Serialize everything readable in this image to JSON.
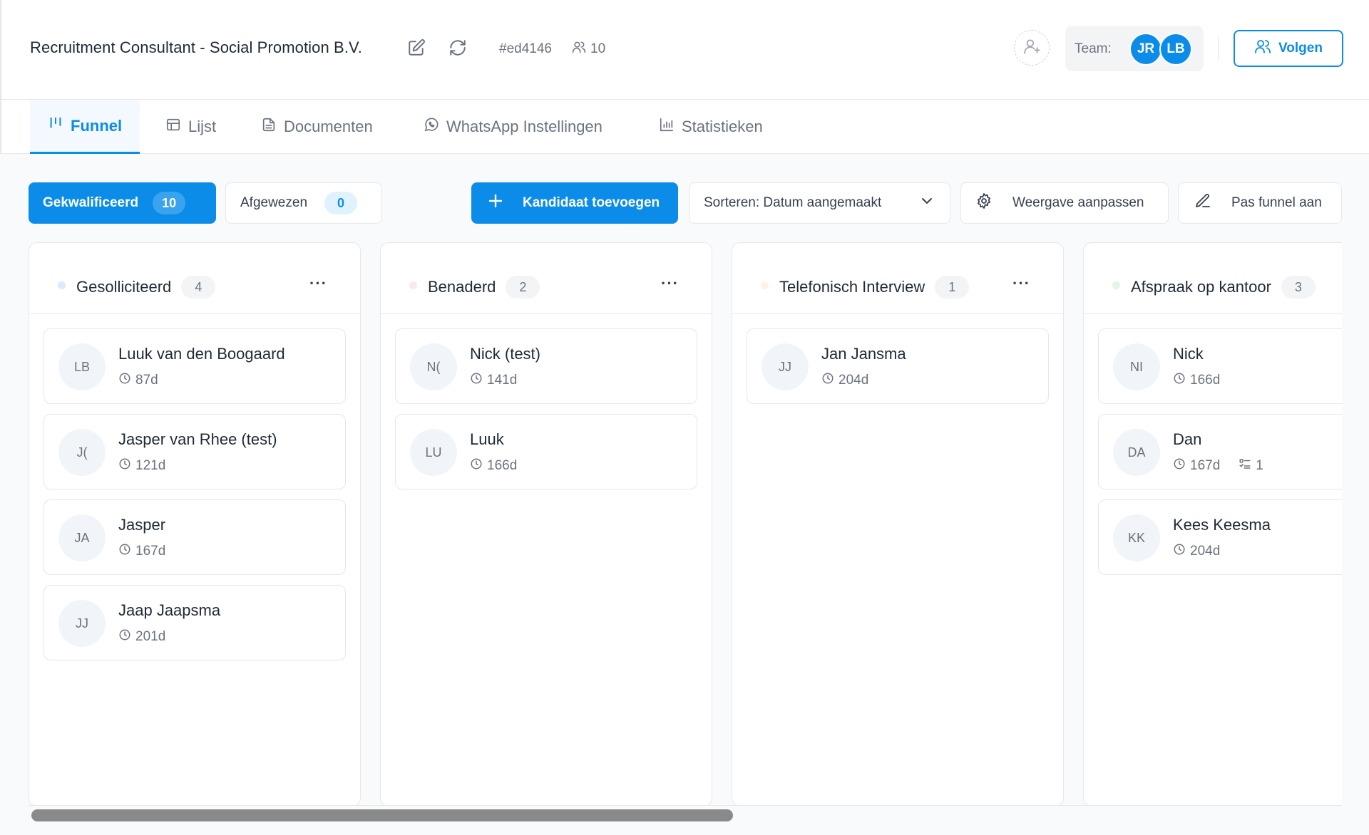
{
  "header": {
    "title": "Recruitment Consultant - Social Promotion B.V.",
    "code": "#ed4146",
    "member_count": "10",
    "team_label": "Team:",
    "team_members": [
      "JR",
      "LB"
    ],
    "follow_label": "Volgen"
  },
  "tabs": [
    {
      "label": "Funnel",
      "icon": "funnel-icon",
      "active": true
    },
    {
      "label": "Lijst",
      "icon": "table-icon",
      "active": false
    },
    {
      "label": "Documenten",
      "icon": "document-icon",
      "active": false
    },
    {
      "label": "WhatsApp Instellingen",
      "icon": "whatsapp-icon",
      "active": false
    },
    {
      "label": "Statistieken",
      "icon": "bar-chart-icon",
      "active": false
    }
  ],
  "toolbar": {
    "qualified": {
      "label": "Gekwalificeerd",
      "count": "10"
    },
    "rejected": {
      "label": "Afgewezen",
      "count": "0"
    },
    "add_candidate": "Kandidaat toevoegen",
    "sort": "Sorteren: Datum aangemaakt",
    "customize_view": "Weergave aanpassen",
    "edit_funnel": "Pas funnel aan"
  },
  "columns": [
    {
      "title": "Gesolliciteerd",
      "count": "4",
      "dot_color": "#dbeafe",
      "cards": [
        {
          "initials": "LB",
          "name": "Luuk van den Boogaard",
          "age": "87d"
        },
        {
          "initials": "J(",
          "name": "Jasper van Rhee (test)",
          "age": "121d"
        },
        {
          "initials": "JA",
          "name": "Jasper",
          "age": "167d"
        },
        {
          "initials": "JJ",
          "name": "Jaap Jaapsma",
          "age": "201d"
        }
      ]
    },
    {
      "title": "Benaderd",
      "count": "2",
      "dot_color": "#fae8f4",
      "cards": [
        {
          "initials": "N(",
          "name": "Nick (test)",
          "age": "141d"
        },
        {
          "initials": "LU",
          "name": "Luuk",
          "age": "166d"
        }
      ]
    },
    {
      "title": "Telefonisch Interview",
      "count": "1",
      "dot_color": "#fef3e2",
      "cards": [
        {
          "initials": "JJ",
          "name": "Jan Jansma",
          "age": "204d"
        }
      ]
    },
    {
      "title": "Afspraak op kantoor",
      "count": "3",
      "dot_color": "#e3f5e6",
      "cards": [
        {
          "initials": "NI",
          "name": "Nick",
          "age": "166d"
        },
        {
          "initials": "DA",
          "name": "Dan",
          "age": "167d",
          "tasks": "1"
        },
        {
          "initials": "KK",
          "name": "Kees Keesma",
          "age": "204d"
        }
      ]
    }
  ],
  "colors": {
    "accent": "#0c8ce9",
    "border": "#e5e7eb",
    "muted": "#6b7280"
  }
}
